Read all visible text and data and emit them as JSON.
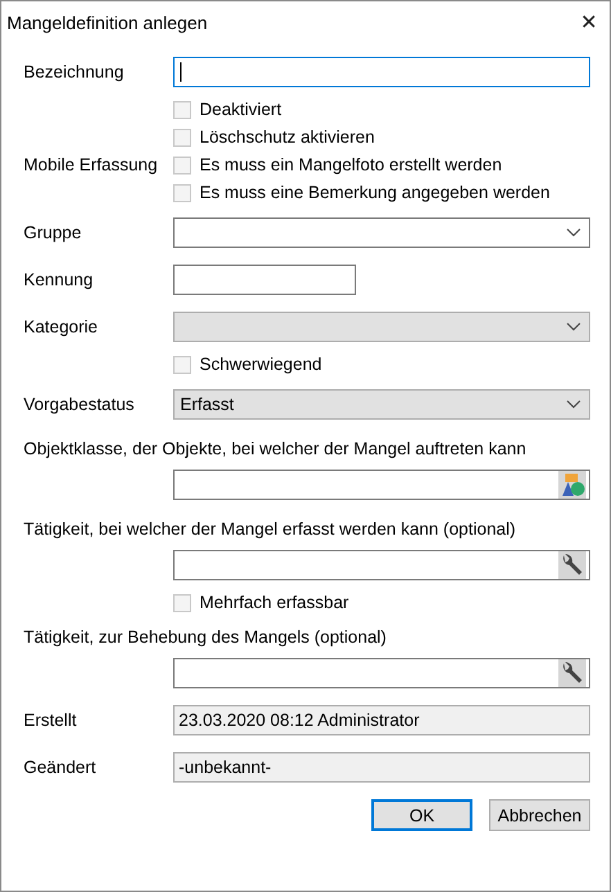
{
  "window": {
    "title": "Mangeldefinition anlegen",
    "close": "✕"
  },
  "rows": [
    {
      "kind": "text",
      "label": "Bezeichnung",
      "focused": true
    },
    {
      "kind": "checkbox",
      "text": "Deaktiviert",
      "checked": false
    },
    {
      "kind": "checkbox",
      "text": "Löschschutz aktivieren",
      "checked": false
    },
    {
      "kind": "checkbox",
      "label": "Mobile Erfassung",
      "text": "Es muss ein Mangelfoto erstellt werden",
      "checked": false
    },
    {
      "kind": "checkbox",
      "text": "Es muss eine Bemerkung angegeben werden",
      "checked": false
    },
    {
      "kind": "combobox",
      "label": "Gruppe"
    },
    {
      "kind": "shorttext",
      "label": "Kennung",
      "focused": false
    },
    {
      "kind": "dropdown",
      "label": "Kategorie"
    },
    {
      "kind": "checkbox",
      "text": "Schwerwiegend",
      "checked": false
    },
    {
      "kind": "dropdown",
      "label": "Vorgabestatus",
      "value": "Erfasst"
    },
    {
      "kind": "caption",
      "text": "Objektklasse, der Objekte, bei welcher der Mangel auftreten kann"
    },
    {
      "kind": "picker"
    },
    {
      "kind": "caption",
      "text": "Tätigkeit, bei welcher der Mangel erfasst werden kann (optional)"
    },
    {
      "kind": "picker"
    },
    {
      "kind": "checkbox",
      "text": "Mehrfach erfassbar",
      "checked": false
    },
    {
      "kind": "caption",
      "text": "Tätigkeit, zur Behebung des Mangels (optional)"
    },
    {
      "kind": "picker"
    },
    {
      "kind": "readonly",
      "label": "Erstellt",
      "value": "23.03.2020 08:12 Administrator"
    },
    {
      "kind": "readonly",
      "label": "Geändert",
      "value": "-unbekannt-"
    }
  ],
  "buttons": [
    {
      "label": "OK",
      "default": true
    },
    {
      "label": "Abbrechen",
      "default": false
    }
  ]
}
